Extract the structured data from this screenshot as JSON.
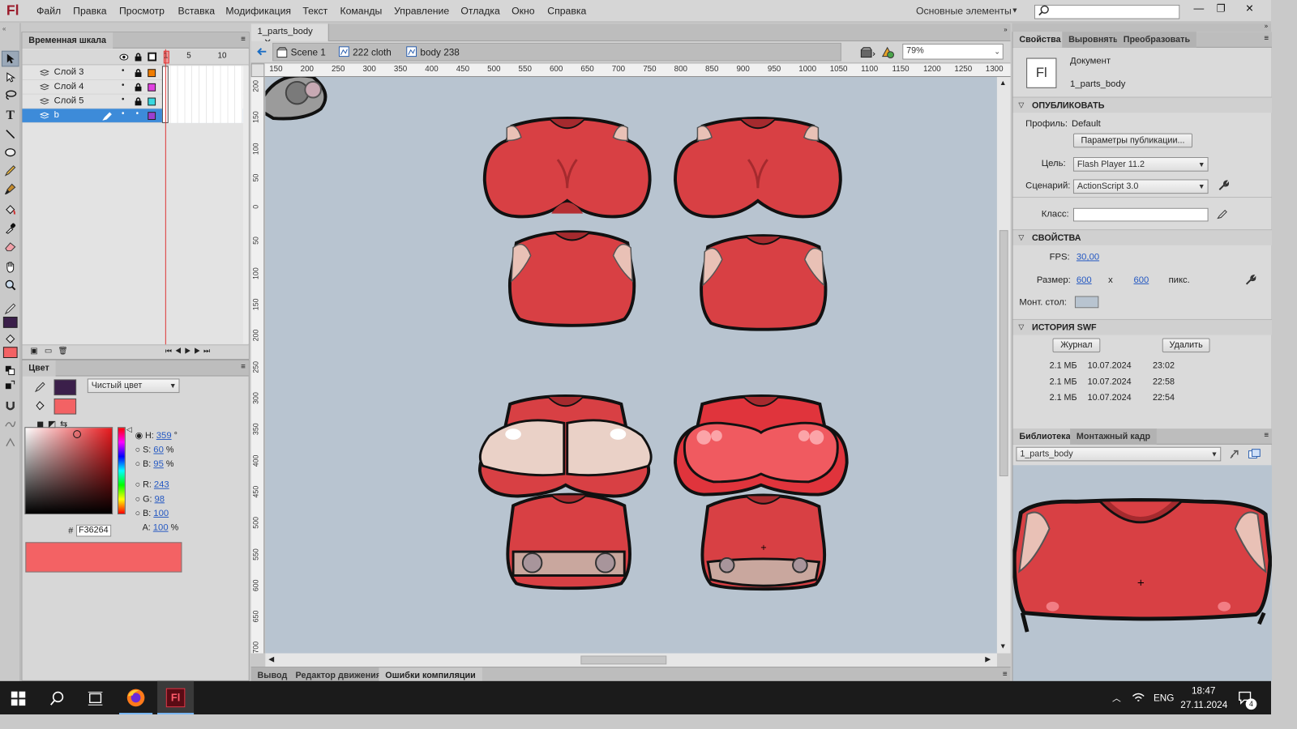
{
  "app": {
    "logo": "Fl",
    "menu": [
      "Файл",
      "Правка",
      "Просмотр",
      "Вставка",
      "Модификация",
      "Текст",
      "Команды",
      "Управление",
      "Отладка",
      "Окно",
      "Справка"
    ],
    "workspace": "Основные элементы"
  },
  "timeline": {
    "tab": "Временная шкала",
    "frame_numbers": [
      "1",
      "5",
      "10"
    ],
    "layers": [
      {
        "name": "Слой 3",
        "color": "#f07c00"
      },
      {
        "name": "Слой 4",
        "color": "#e040e0"
      },
      {
        "name": "Слой 5",
        "color": "#38d8e0"
      },
      {
        "name": "b",
        "color": "#9a3fd0"
      }
    ]
  },
  "color_panel": {
    "tab": "Цвет",
    "fill_type": "Чистый цвет",
    "stroke_color": "#3b1f4a",
    "fill_color": "#f36264",
    "hsb": {
      "h": "359",
      "h_unit": "°",
      "s": "60",
      "s_unit": "%",
      "b": "95",
      "b_unit": "%"
    },
    "rgb": {
      "r": "243",
      "g": "98",
      "b": "100"
    },
    "alpha": "100",
    "alpha_unit": "%",
    "hex_prefix": "#",
    "hex": "F36264",
    "labels": {
      "h": "H:",
      "s": "S:",
      "b": "B:",
      "r": "R:",
      "g": "G:",
      "bb": "B:",
      "a": "A:"
    }
  },
  "document": {
    "tab": "1_parts_body",
    "breadcrumb": [
      "Scene 1",
      "222 cloth",
      "body 238"
    ],
    "zoom": "79%",
    "ruler_top": [
      "150",
      "200",
      "250",
      "300",
      "350",
      "400",
      "450",
      "500",
      "550",
      "600",
      "650",
      "700",
      "750",
      "800",
      "850",
      "900",
      "950",
      "1000",
      "1050",
      "1100",
      "1150",
      "1200",
      "1250",
      "1300"
    ],
    "ruler_left": [
      "200",
      "150",
      "100",
      "50",
      "0",
      "50",
      "100",
      "150",
      "200",
      "250",
      "300",
      "350",
      "400",
      "450",
      "500",
      "550",
      "600",
      "650",
      "700"
    ],
    "stage_color": "#b8c4d0"
  },
  "bottom_tabs": [
    "Вывод",
    "Редактор движения",
    "Ошибки компиляции"
  ],
  "properties": {
    "tabs": [
      "Свойства",
      "Выровнять",
      "Преобразовать"
    ],
    "doc_type": "Документ",
    "doc_icon": "Fl",
    "doc_name": "1_parts_body",
    "publish": {
      "header": "ОПУБЛИКОВАТЬ",
      "profile_label": "Профиль:",
      "profile_value": "Default",
      "settings_button": "Параметры публикации...",
      "target_label": "Цель:",
      "target_value": "Flash Player 11.2",
      "script_label": "Сценарий:",
      "script_value": "ActionScript 3.0",
      "class_label": "Класс:"
    },
    "properties": {
      "header": "СВОЙСТВА",
      "fps_label": "FPS:",
      "fps_value": "30,00",
      "size_label": "Размер:",
      "width": "600",
      "x": "x",
      "height": "600",
      "unit": "пикс.",
      "stage_label": "Монт. стол:"
    },
    "swf_history": {
      "header": "ИСТОРИЯ SWF",
      "log_button": "Журнал",
      "delete_button": "Удалить",
      "entries": [
        {
          "size": "2.1 МБ",
          "date": "10.07.2024",
          "time": "23:02"
        },
        {
          "size": "2.1 МБ",
          "date": "10.07.2024",
          "time": "22:58"
        },
        {
          "size": "2.1 МБ",
          "date": "10.07.2024",
          "time": "22:54"
        }
      ]
    }
  },
  "library": {
    "tabs": [
      "Библиотека",
      "Монтажный кадр"
    ],
    "selected": "1_parts_body"
  },
  "taskbar": {
    "lang": "ENG",
    "time": "18:47",
    "date": "27.11.2024",
    "notifications": "4"
  }
}
